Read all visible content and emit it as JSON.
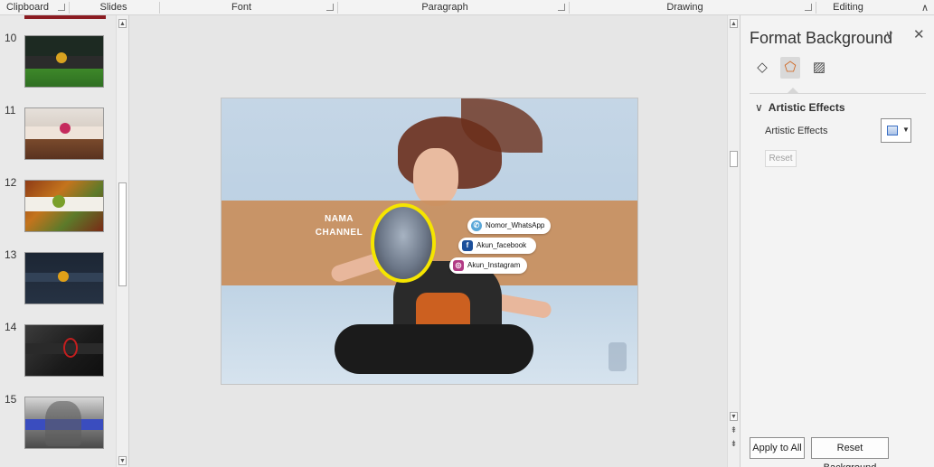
{
  "ribbon": {
    "groups": [
      "Clipboard",
      "Slides",
      "Font",
      "Paragraph",
      "Drawing",
      "Editing"
    ],
    "collapse_icon": "chevron-up-icon"
  },
  "thumbnails": {
    "slides": [
      {
        "number": "10",
        "theme": "stadium"
      },
      {
        "number": "11",
        "theme": "wood-steam"
      },
      {
        "number": "12",
        "theme": "food"
      },
      {
        "number": "13",
        "theme": "dark-blue"
      },
      {
        "number": "14",
        "theme": "black-red"
      },
      {
        "number": "15",
        "theme": "bird-purple"
      }
    ]
  },
  "slide": {
    "channel_line1": "NAMA",
    "channel_line2": "CHANNEL",
    "pills": [
      {
        "label": "Nomor_WhatsApp",
        "icon": "whatsapp-icon",
        "color": "#5aa7d8"
      },
      {
        "label": "Akun_facebook",
        "icon": "facebook-icon",
        "color": "#1c4f9a"
      },
      {
        "label": "Akun_Instagram",
        "icon": "instagram-icon",
        "color": "#b23a85"
      }
    ],
    "band_color": "#c98f5e",
    "ring_color": "#f5e500"
  },
  "pane": {
    "title": "Format Background",
    "tabs": [
      {
        "name": "fill-icon",
        "glyph": "◇"
      },
      {
        "name": "effects-icon",
        "glyph": "⬠"
      },
      {
        "name": "picture-icon",
        "glyph": "▨"
      }
    ],
    "section_label": "Artistic Effects",
    "effects_label": "Artistic Effects",
    "reset_label": "Reset",
    "apply_all_label": "Apply to All",
    "reset_bg_label": "Reset Background"
  }
}
